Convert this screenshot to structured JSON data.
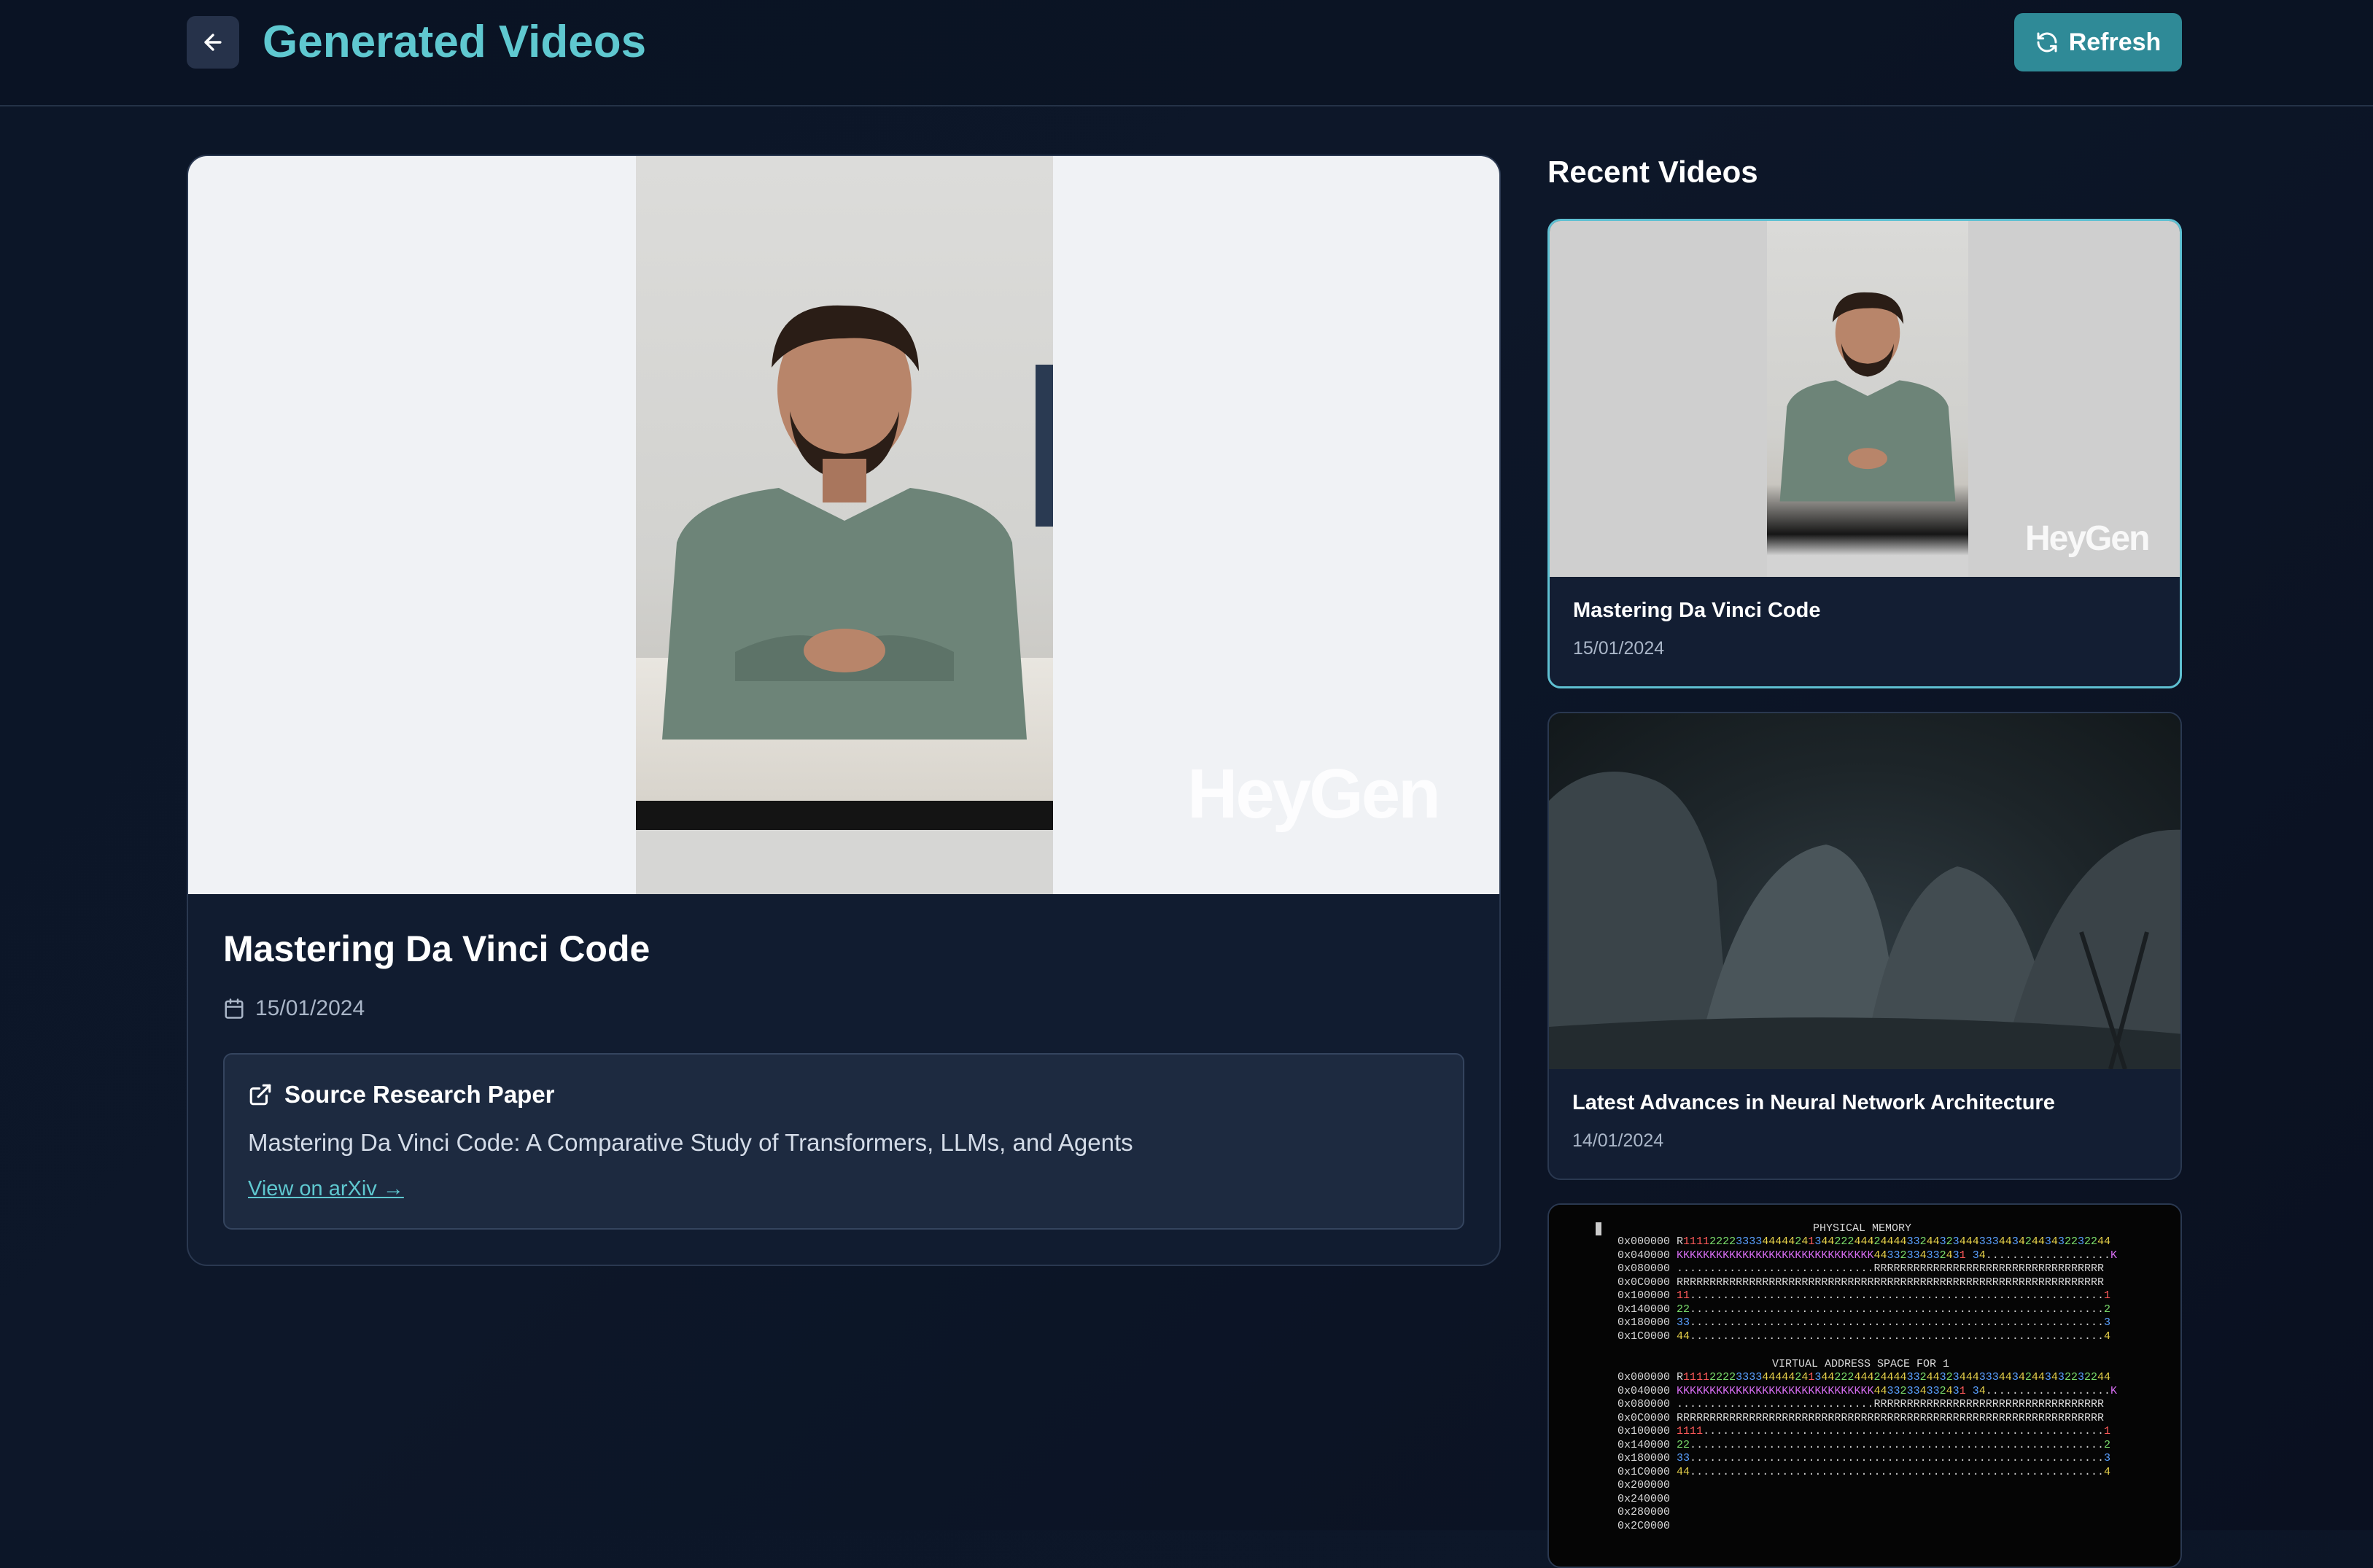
{
  "header": {
    "title": "Generated Videos",
    "refresh_label": "Refresh"
  },
  "player": {
    "watermark": "HeyGen",
    "title": "Mastering Da Vinci Code",
    "date": "15/01/2024",
    "source": {
      "heading": "Source Research Paper",
      "paper_title": "Mastering Da Vinci Code: A Comparative Study of Transformers, LLMs, and Agents",
      "link_label": "View on arXiv →"
    }
  },
  "sidebar": {
    "heading": "Recent Videos",
    "videos": [
      {
        "title": "Mastering Da Vinci Code",
        "date": "15/01/2024",
        "watermark": "HeyGen"
      },
      {
        "title": "Latest Advances in Neural Network Architecture",
        "date": "14/01/2024"
      },
      {
        "title": "",
        "memory": {
          "physical_heading": "PHYSICAL MEMORY",
          "virtual_heading": "VIRTUAL ADDRESS SPACE FOR 1",
          "physical_rows": [
            "0x000000 R11112222333344444241344222444244443324432344433344342443432232244",
            "0x040000 KKKKKKKKKKKKKKKKKKKKKKKKKKKKKK44332334332431 34...................K",
            "0x080000 ..............................RRRRRRRRRRRRRRRRRRRRRRRRRRRRRRRRRRR",
            "0x0C0000 RRRRRRRRRRRRRRRRRRRRRRRRRRRRRRRRRRRRRRRRRRRRRRRRRRRRRRRRRRRRRRRRR",
            "0x100000 11...............................................................1",
            "0x140000 22...............................................................2",
            "0x180000 33...............................................................3",
            "0x1C0000 44...............................................................4"
          ],
          "virtual_rows": [
            "0x000000 R11112222333344444241344222444244443324432344433344342443432232244",
            "0x040000 KKKKKKKKKKKKKKKKKKKKKKKKKKKKKK44332334332431 34...................K",
            "0x080000 ..............................RRRRRRRRRRRRRRRRRRRRRRRRRRRRRRRRRRR",
            "0x0C0000 RRRRRRRRRRRRRRRRRRRRRRRRRRRRRRRRRRRRRRRRRRRRRRRRRRRRRRRRRRRRRRRRR",
            "0x100000 1111.............................................................1",
            "0x140000 22...............................................................2",
            "0x180000 33...............................................................3",
            "0x1C0000 44...............................................................4",
            "0x200000",
            "0x240000",
            "0x280000",
            "0x2C0000"
          ]
        }
      }
    ]
  },
  "colors": {
    "accent": "#5fc8d0",
    "refresh_bg": "#2f8a97",
    "card_bg": "#111c30",
    "page_bg": "#0c1628"
  },
  "icons": {
    "back": "arrow-left-icon",
    "refresh": "refresh-icon",
    "date": "calendar-icon",
    "source": "external-link-icon"
  }
}
